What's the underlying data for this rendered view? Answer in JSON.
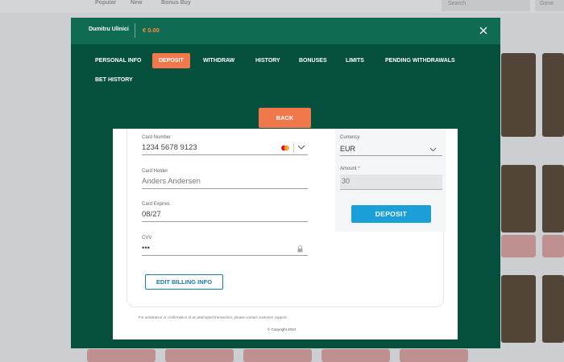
{
  "background": {
    "nav": [
      "Popular",
      "New",
      "Bonus Buy"
    ],
    "search_placeholder": "Search",
    "gen_label": "Gene"
  },
  "header": {
    "username": "Dumitru Ulinici",
    "balance": "€ 0.00"
  },
  "tabs": [
    {
      "label": "PERSONAL INFO",
      "active": false
    },
    {
      "label": "DEPOSIT",
      "active": true
    },
    {
      "label": "WITHDRAW",
      "active": false
    },
    {
      "label": "HISTORY",
      "active": false
    },
    {
      "label": "BONUSES",
      "active": false
    },
    {
      "label": "LIMITS",
      "active": false
    },
    {
      "label": "PENDING WITHDRAWALS",
      "active": false
    },
    {
      "label": "BET HISTORY",
      "active": false
    }
  ],
  "back_label": "BACK",
  "form": {
    "card_number": {
      "label": "Card Number",
      "value": "1234 5678 9123"
    },
    "card_holder": {
      "label": "Card Holder",
      "value": "Anders Andersen"
    },
    "card_expires": {
      "label": "Card Expires",
      "value": "08/27"
    },
    "cvv": {
      "label": "CVV",
      "value": "•••"
    },
    "currency": {
      "label": "Currency",
      "value": "EUR"
    },
    "amount": {
      "label": "Amount",
      "required_mark": "*",
      "value": "30"
    },
    "deposit_label": "DEPOSIT",
    "billing_label": "EDIT BILLING INFO"
  },
  "footer": {
    "assist_text": "For assistance or confirmation of an attempted transaction, please contact customer support.",
    "copyright": "© Copyright 2024"
  },
  "colors": {
    "modal_bg": "#05503c",
    "header_bg": "#0f6b52",
    "accent_orange": "#f0784a",
    "deposit_blue": "#1a9fd8"
  }
}
